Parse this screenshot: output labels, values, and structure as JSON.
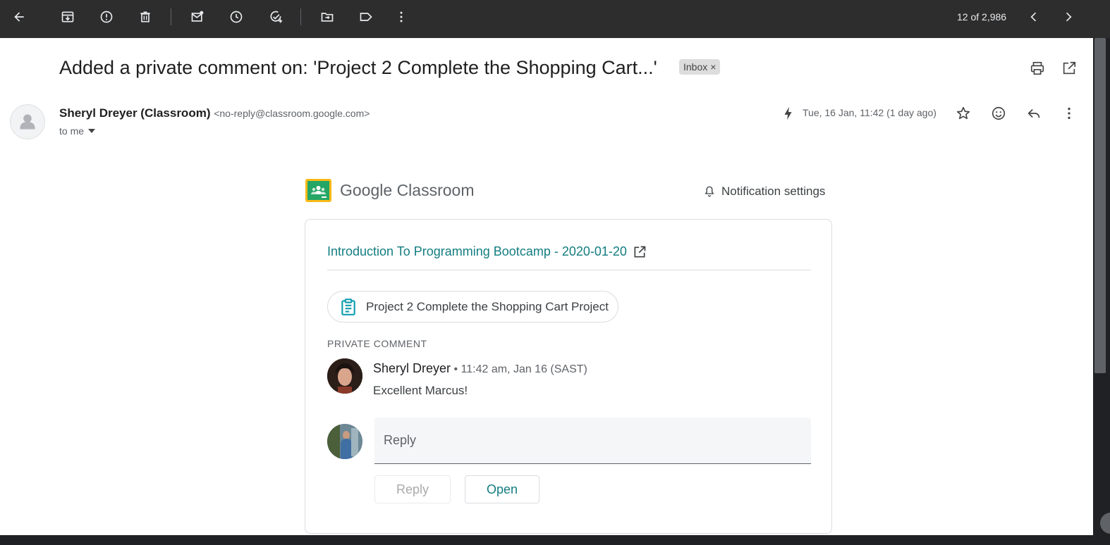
{
  "toolbar": {
    "icons": [
      "back-arrow-icon",
      "archive-icon",
      "report-spam-icon",
      "delete-icon",
      "mark-unread-icon",
      "snooze-icon",
      "add-task-icon",
      "move-to-icon",
      "label-icon",
      "more-vert-icon"
    ],
    "page_count": "12 of 2,986"
  },
  "email": {
    "subject": "Added a private comment on: 'Project 2 Complete the Shopping Cart...'",
    "label_chip": "Inbox",
    "label_chip_close": "×",
    "sender_name": "Sheryl Dreyer (Classroom)",
    "sender_email": "<no-reply@classroom.google.com>",
    "recipient": "to me",
    "date": "Tue, 16 Jan, 11:42 (1 day ago)"
  },
  "body": {
    "brand_google": "Google",
    "brand_product": "Classroom",
    "notification_settings": "Notification settings",
    "course_title": "Introduction To Programming Bootcamp - 2020-01-20",
    "assignment_title": "Project 2 Complete the Shopping Cart Project",
    "section_label": "PRIVATE COMMENT",
    "comment": {
      "author": "Sheryl Dreyer",
      "meta": " • 11:42 am, Jan 16 (SAST)",
      "text": "Excellent Marcus!"
    },
    "reply_placeholder": "Reply",
    "reply_button": "Reply",
    "open_button": "Open"
  },
  "colors": {
    "toolbar_bg": "#2d2d2d",
    "teal_link": "#137d80",
    "classroom_green": "#25a667",
    "classroom_yellow": "#f9ba16"
  }
}
